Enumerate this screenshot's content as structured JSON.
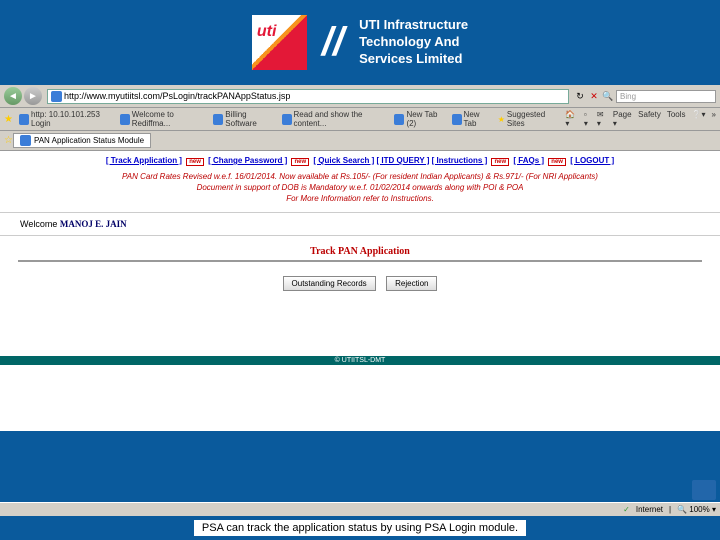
{
  "header": {
    "company_line1": "UTI Infrastructure",
    "company_line2": "Technology And",
    "company_line3": "Services Limited",
    "slash": "//"
  },
  "browser": {
    "url": "http://www.myutiitsl.com/PsLogin/trackPANAppStatus.jsp",
    "search_placeholder": "Bing",
    "bookmarks": {
      "b1": "http: 10.10.101.253 Login",
      "b2": "Welcome to Rediffma...",
      "b3": "Billing Software",
      "b4": "Read and show the content...",
      "b5": "New Tab (2)",
      "b6": "New Tab",
      "b7": "Suggested Sites"
    },
    "toolbar": {
      "home": "Home",
      "safety": "Safety",
      "tools": "Tools"
    },
    "tab_title": "PAN Application Status Module",
    "chevron": "»"
  },
  "nav": {
    "track": "[ Track Application ]",
    "change_pw": "[ Change Password ]",
    "quick": "[ Quick Search ]",
    "itd": "[ ITD QUERY ]",
    "instr": "[ Instructions ]",
    "faqs": "[ FAQs ]",
    "logout": "[ LOGOUT ]",
    "new": "new"
  },
  "notices": {
    "n1": "PAN Card Rates Revised w.e.f. 16/01/2014. Now available at Rs.105/- (For resident Indian Applicants) & Rs.971/- (For NRI Applicants)",
    "n2": "Document in support of DOB is Mandatory w.e.f. 01/02/2014 onwards along with POI & POA",
    "n3": "For More Information refer to Instructions."
  },
  "welcome": {
    "label": "Welcome ",
    "user": "MANOJ E. JAIN"
  },
  "section": {
    "title": "Track PAN Application"
  },
  "buttons": {
    "outstanding": "Outstanding Records",
    "rejection": "Rejection"
  },
  "footer": "© UTIITSL-DMT",
  "status": {
    "internet": "Internet",
    "zoom": "100%"
  },
  "caption": "PSA can track the application status by using PSA Login module."
}
